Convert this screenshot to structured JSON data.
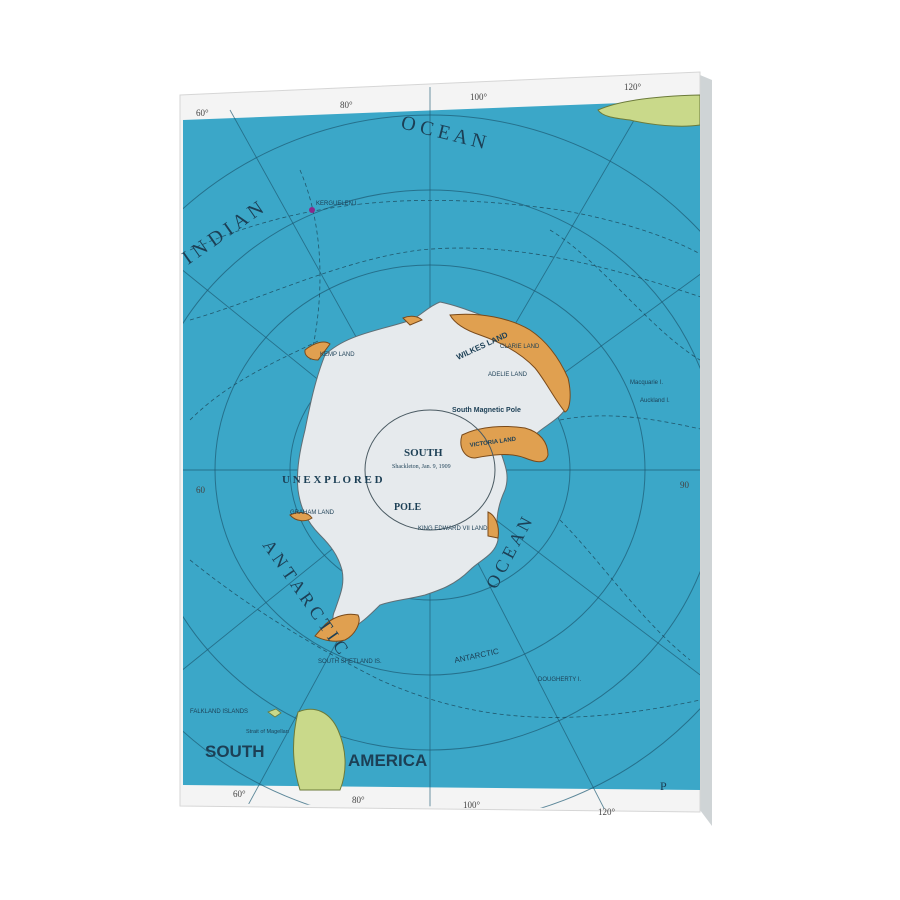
{
  "map": {
    "ocean_labels": {
      "indian": "I N D I A N",
      "ocean_top": "O C E A N",
      "antarctic": "A N T A R C T I C",
      "ocean_right": "O C E A N",
      "antarctic_small": "ANTARCTIC"
    },
    "continent": {
      "south": "SOUTH",
      "pole": "POLE",
      "unexplored": "U N E X P L O R E D",
      "south_magnetic_pole": "South Magnetic Pole",
      "king_edward": "KING EDWARD VII LAND",
      "victoria_land": "VICTORIA LAND",
      "wilkes_land": "WILKES LAND",
      "adelie_land": "ADELIE LAND",
      "clarie_land": "CLARIE LAND",
      "kemp_land": "KEMP LAND",
      "graham_land": "GRAHAM LAND",
      "shackleton": "Shackleton, Jan. 9, 1909"
    },
    "places": {
      "south_america_1": "SOUTH",
      "south_america_2": "AMERICA",
      "kerguelen": "KERGUELEN I.",
      "south_shetland": "SOUTH SHETLAND IS.",
      "falkland": "FALKLAND ISLANDS",
      "magellan": "Strait of Magellan",
      "macquarie": "Macquarie I.",
      "auckland": "Auckland I.",
      "dougherty": "DOUGHERTY I."
    },
    "top_ticks": [
      "60°",
      "80°",
      "100°",
      "120°"
    ],
    "bottom_ticks": [
      "60°",
      "80°",
      "100°",
      "120°"
    ],
    "side_marks": [
      "60",
      "60",
      "90"
    ],
    "corner_letter": "P",
    "colors": {
      "ocean": "#3aa9c9",
      "ice": "#e8ecef",
      "land_orange": "#e0a050",
      "land_green": "#c9d98a",
      "frame": "#f2f2f2"
    }
  }
}
